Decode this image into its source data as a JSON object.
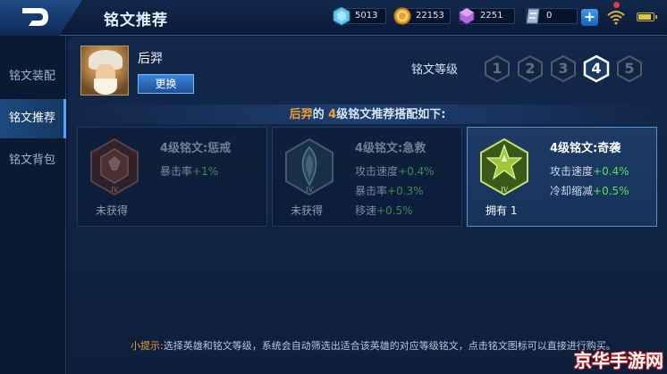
{
  "header": {
    "title": "铭文推荐",
    "resources": [
      {
        "icon": "blue-crystal-icon",
        "value": "5013"
      },
      {
        "icon": "gold-coin-icon",
        "value": "22153"
      },
      {
        "icon": "purple-crystal-icon",
        "value": "2251"
      },
      {
        "icon": "diamond-voucher-icon",
        "value": "0"
      }
    ],
    "plus_label": "+",
    "battery_level": 0.85
  },
  "sidebar": {
    "items": [
      {
        "label": "铭文装配",
        "active": false
      },
      {
        "label": "铭文推荐",
        "active": true
      },
      {
        "label": "铭文背包",
        "active": false
      }
    ]
  },
  "hero": {
    "name": "后羿",
    "change_label": "更换"
  },
  "level_selector": {
    "label": "铭文等级",
    "levels": [
      "1",
      "2",
      "3",
      "4",
      "5"
    ],
    "selected": "4"
  },
  "headline": {
    "hero": "后羿",
    "part1": "的 ",
    "level": "4",
    "part2": "级铭文推荐搭配如下:"
  },
  "cards": [
    {
      "title": "4级铭文:惩戒",
      "stats": [
        {
          "name": "暴击率",
          "value": "+1%"
        }
      ],
      "status": "未获得",
      "owned": false,
      "emblem_color": "#8a3a2a",
      "tier": "IV"
    },
    {
      "title": "4级铭文:急救",
      "stats": [
        {
          "name": "攻击速度",
          "value": "+0.4%"
        },
        {
          "name": "暴击率",
          "value": "+0.3%"
        },
        {
          "name": "移速",
          "value": "+0.5%"
        }
      ],
      "status": "未获得",
      "owned": false,
      "emblem_color": "#3b5f6e",
      "tier": "IV"
    },
    {
      "title": "4级铭文:奇袭",
      "stats": [
        {
          "name": "攻击速度",
          "value": "+0.4%"
        },
        {
          "name": "冷却缩减",
          "value": "+0.5%"
        }
      ],
      "status": "拥有",
      "count": "1",
      "owned": true,
      "emblem_color": "#7fa83a",
      "tier": "IV"
    }
  ],
  "tip": {
    "key": "小提示:",
    "text": "选择英雄和铭文等级，系统会自动筛选出适合该英雄的对应等级铭文，点击铭文图标可以直接进行购买。"
  },
  "watermark": "京华手游网"
}
